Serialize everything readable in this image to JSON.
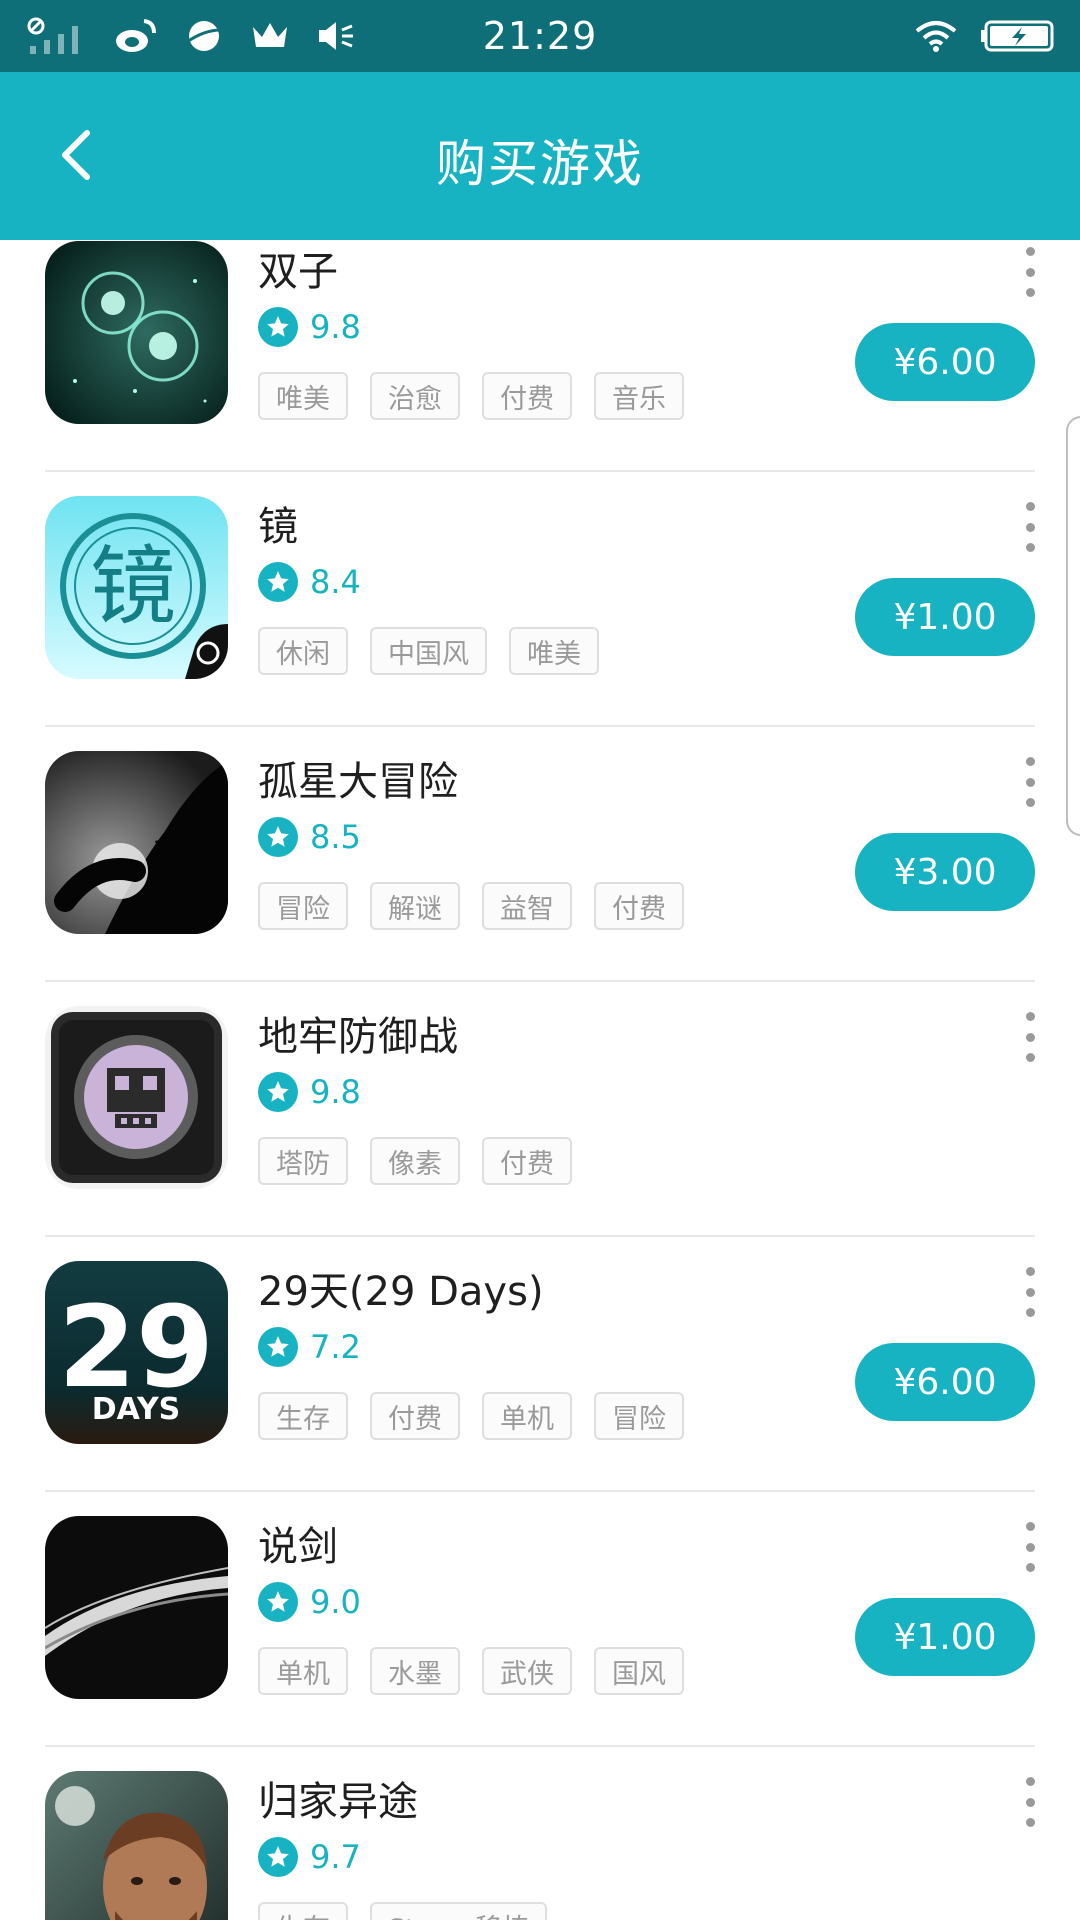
{
  "status_bar": {
    "time": "21:29"
  },
  "header": {
    "title": "购买游戏"
  },
  "games": [
    {
      "name": "双子",
      "score": "9.8",
      "tags": [
        "唯美",
        "治愈",
        "付费",
        "音乐"
      ],
      "price": "¥6.00"
    },
    {
      "name": "镜",
      "score": "8.4",
      "tags": [
        "休闲",
        "中国风",
        "唯美"
      ],
      "price": "¥1.00"
    },
    {
      "name": "孤星大冒险",
      "score": "8.5",
      "tags": [
        "冒险",
        "解谜",
        "益智",
        "付费"
      ],
      "price": "¥3.00"
    },
    {
      "name": "地牢防御战",
      "score": "9.8",
      "tags": [
        "塔防",
        "像素",
        "付费"
      ],
      "price": ""
    },
    {
      "name": "29天(29 Days)",
      "score": "7.2",
      "tags": [
        "生存",
        "付费",
        "单机",
        "冒险"
      ],
      "price": "¥6.00"
    },
    {
      "name": "说剑",
      "score": "9.0",
      "tags": [
        "单机",
        "水墨",
        "武侠",
        "国风"
      ],
      "price": "¥1.00"
    },
    {
      "name": "归家异途",
      "score": "9.7",
      "tags": [
        "生存",
        "Steam移植"
      ],
      "price": ""
    }
  ],
  "thumb_texts": {
    "jing_char": "镜",
    "days_big": "29",
    "days_small": "DAYS"
  },
  "icons": {
    "status_left": [
      "signal-icon",
      "weibo-icon",
      "planet-icon",
      "crown-icon",
      "vibrate-icon"
    ],
    "status_right": [
      "wifi-icon",
      "battery-icon"
    ],
    "back": "back-arrow-icon",
    "star": "star-icon",
    "more": "more-vertical-icon"
  },
  "colors": {
    "accent": "#17b3c3",
    "status_bar": "#0f6f78"
  }
}
